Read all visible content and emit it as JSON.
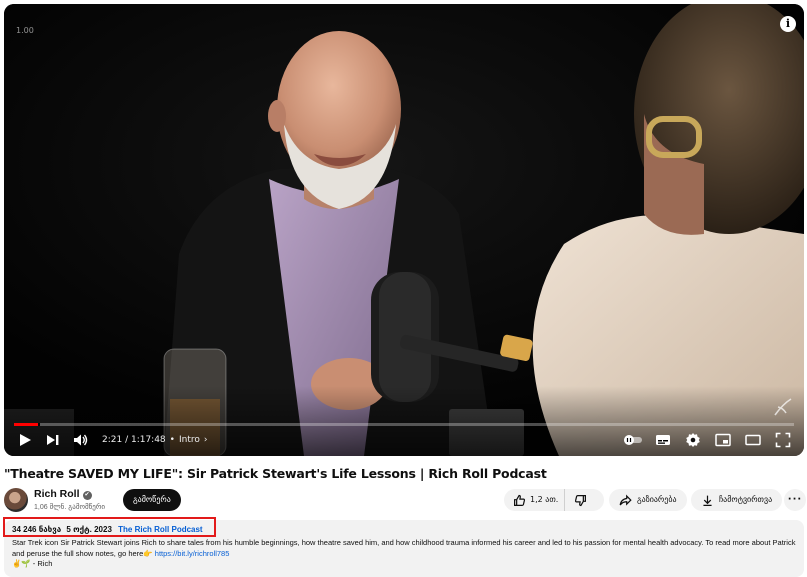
{
  "player": {
    "speed_overlay": "1.00",
    "info_icon": "info-icon",
    "progress_fraction": 0.0313,
    "time_display": "2:21 / 1:17:48",
    "chapter": "Intro",
    "chapter_separator": "•",
    "chapter_chevron": "›",
    "controls_left": [
      "play-icon",
      "next-icon",
      "volume-icon"
    ],
    "controls_right": [
      "autoplay-toggle-icon",
      "subtitles-icon",
      "settings-gear-icon",
      "miniplayer-icon",
      "theater-mode-icon",
      "fullscreen-icon"
    ]
  },
  "video": {
    "title": "\"Theatre SAVED MY LIFE\": Sir Patrick Stewart's Life Lessons | Rich Roll Podcast"
  },
  "channel": {
    "name": "Rich Roll",
    "verified_icon": "✔",
    "subscribers": "1,06 მლნ. გამომწერი",
    "subscribe_label": "გამოწერა"
  },
  "actions": {
    "likes": "1,2 ათ.",
    "share_label": "გაზიარება",
    "download_label": "ჩამოტვირთვა",
    "more_label": "···"
  },
  "description": {
    "views": "34 246 ნახვა",
    "date": "5 ოქტ. 2023",
    "playlist": "The Rich Roll Podcast",
    "body": "Star Trek icon Sir Patrick Stewart joins Rich to share tales from his humble beginnings, how theatre saved him, and how childhood trauma informed his career and led to his passion for mental health advocacy. To read more about Patrick and peruse the full show notes, go here",
    "pointer_emoji": "👉",
    "link": "https://bit.ly/richroll785",
    "signature_emoji": "✌️🌱",
    "signature": "- Rich"
  },
  "colors": {
    "progress": "#ff0000",
    "highlight": "#e21a1a",
    "link": "#065fd4",
    "subscribe_bg": "#0f0f0f"
  }
}
